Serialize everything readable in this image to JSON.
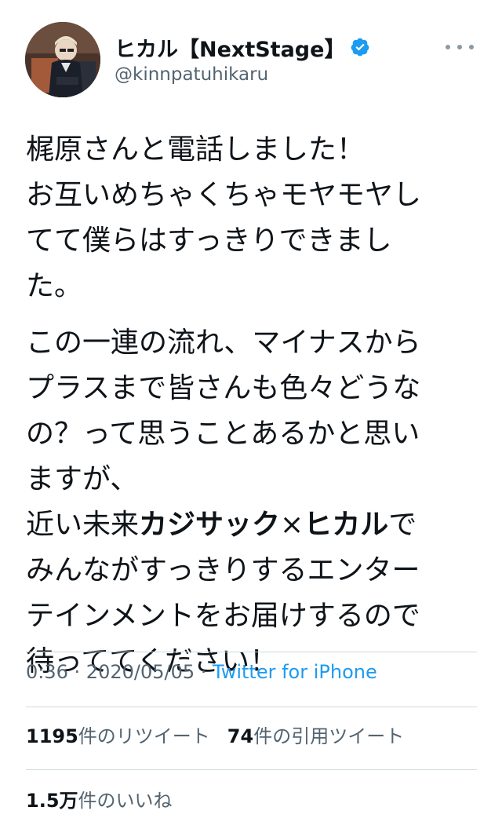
{
  "user": {
    "display_name": "ヒカル【NextStage】",
    "handle": "@kinnpatuhikaru",
    "verified": true
  },
  "tweet": {
    "paragraph1_lines": [
      "梶原さんと電話しました！",
      "お互いめちゃくちゃモヤモヤし",
      "てて僕らはすっきりできまし",
      "た。"
    ],
    "paragraph2_lines": [
      "この一連の流れ、マイナスから",
      "プラスまで皆さんも色々どうな",
      "の？って思うことあるかと思い",
      "ますが、"
    ],
    "line_prefix": "近い未来",
    "bold1": "カジサック",
    "cross": "×",
    "bold2": "ヒカル",
    "line_suffix": "で",
    "paragraph3_lines": [
      "みんながすっきりするエンター",
      "テインメントをお届けするので",
      "待っててください！"
    ]
  },
  "meta": {
    "time": "0:36",
    "sep1": " · ",
    "date": "2020/05/05",
    "sep2": " · ",
    "source": "Twitter for iPhone"
  },
  "stats": {
    "retweets_count": "1195",
    "retweets_label": "件のリツイート",
    "quotes_count": "74",
    "quotes_label": "件の引用ツイート",
    "likes_count": "1.5万",
    "likes_label": "件のいいね"
  },
  "colors": {
    "text": "#0f1419",
    "secondary": "#536471",
    "link": "#1d9bf0",
    "verified": "#1d9bf0",
    "divider": "#cfd9de"
  },
  "icons": {
    "verified": "verified-badge-icon",
    "more": "more-options-icon"
  }
}
